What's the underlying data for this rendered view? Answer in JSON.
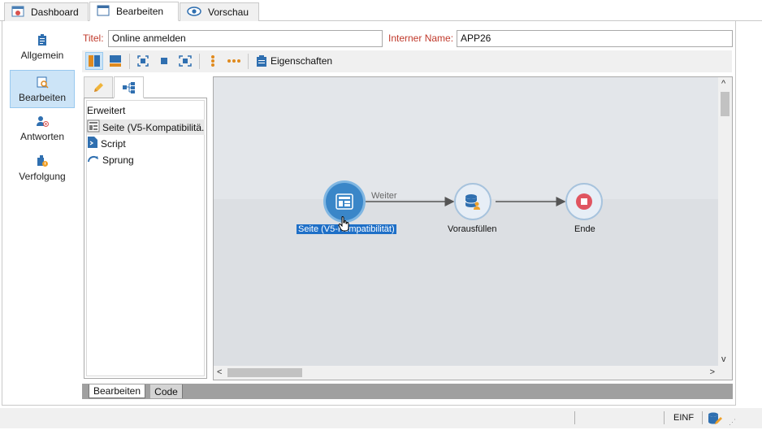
{
  "tabs": {
    "dashboard": "Dashboard",
    "edit": "Bearbeiten",
    "preview": "Vorschau"
  },
  "sidebar": {
    "items": [
      {
        "label": "Allgemein"
      },
      {
        "label": "Bearbeiten"
      },
      {
        "label": "Antworten"
      },
      {
        "label": "Verfolgung"
      }
    ]
  },
  "form": {
    "title_label": "Titel:",
    "title_value": "Online anmelden",
    "internal_label": "Interner Name:",
    "internal_value": "APP26"
  },
  "toolbar": {
    "properties_label": "Eigenschaften"
  },
  "palette": {
    "group": "Erweitert",
    "items": [
      {
        "label": "Seite (V5-Kompatibilitä..."
      },
      {
        "label": "Script"
      },
      {
        "label": "Sprung"
      }
    ]
  },
  "workflow": {
    "nodes": [
      {
        "label": "Seite (V5-Kompatibilität)"
      },
      {
        "label": "Vorausfüllen"
      },
      {
        "label": "Ende"
      }
    ],
    "edge_label": "Weiter"
  },
  "bottom_tabs": {
    "edit": "Bearbeiten",
    "code": "Code"
  },
  "status": {
    "insert_mode": "EINF"
  },
  "colors": {
    "accent": "#1e6fc7",
    "label_red": "#c0392b",
    "selection": "#cce4f7"
  }
}
